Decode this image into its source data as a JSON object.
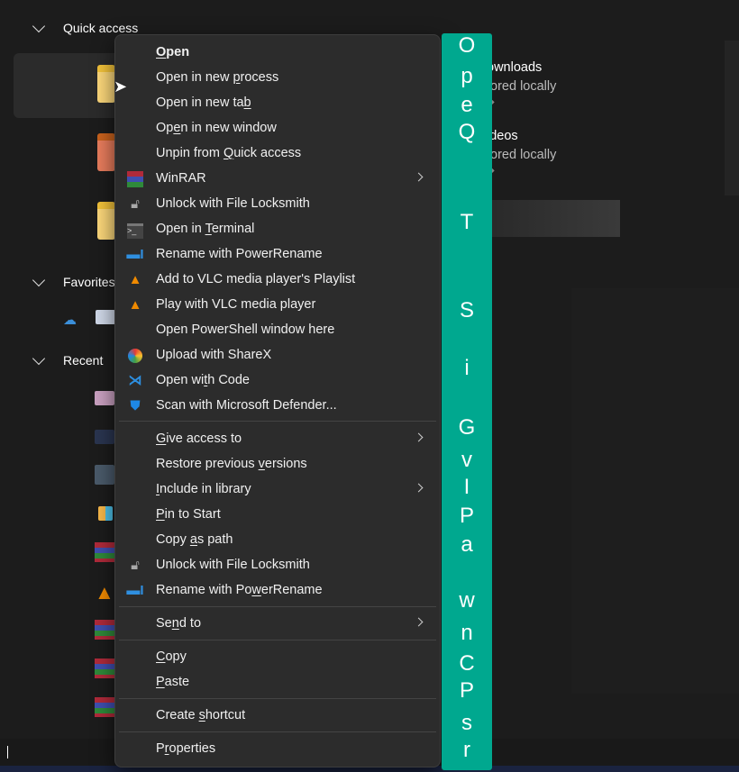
{
  "sidebar": {
    "quick_access": "Quick access",
    "favorites": "Favorites",
    "recent": "Recent"
  },
  "right_items": [
    {
      "name": "Downloads",
      "visible_name": "ownloads",
      "status": "Stored locally",
      "visible_status": "tored locally"
    },
    {
      "name": "Videos",
      "visible_name": "ideos",
      "status": "Stored locally",
      "visible_status": "tored locally"
    }
  ],
  "context_menu": {
    "groups": [
      [
        {
          "label": "Open",
          "key": 0,
          "bold": true
        },
        {
          "label": "Open in new process",
          "key": 12
        },
        {
          "label": "Open in new tab",
          "key": 14
        },
        {
          "label": "Open in new window",
          "key": 2
        },
        {
          "label": "Unpin from Quick access",
          "key": 11
        },
        {
          "label": "WinRAR",
          "icon": "winrar-icon",
          "submenu": true
        },
        {
          "label": "Unlock with File Locksmith",
          "icon": "lock-icon"
        },
        {
          "label": "Open in Terminal",
          "key": 8,
          "icon": "terminal-icon"
        },
        {
          "label": "Rename with PowerRename",
          "icon": "powerrename-icon"
        },
        {
          "label": "Add to VLC media player's Playlist",
          "icon": "vlc-icon"
        },
        {
          "label": "Play with VLC media player",
          "icon": "vlc-icon"
        },
        {
          "label": "Open PowerShell window here"
        },
        {
          "label": "Upload with ShareX",
          "icon": "sharex-icon"
        },
        {
          "label": "Open with Code",
          "key": 7,
          "icon": "vscode-icon"
        },
        {
          "label": "Scan with Microsoft Defender...",
          "icon": "defender-shield-icon"
        }
      ],
      [
        {
          "label": "Give access to",
          "key": 0,
          "submenu": true
        },
        {
          "label": "Restore previous versions",
          "key": 17
        },
        {
          "label": "Include in library",
          "key": 0,
          "submenu": true
        },
        {
          "label": "Pin to Start",
          "key": 0
        },
        {
          "label": "Copy as path",
          "key": 5
        },
        {
          "label": "Unlock with File Locksmith",
          "icon": "lock-icon"
        },
        {
          "label": "Rename with PowerRename",
          "key": 14,
          "icon": "powerrename-icon"
        }
      ],
      [
        {
          "label": "Send to",
          "key": 2,
          "submenu": true
        }
      ],
      [
        {
          "label": "Copy",
          "key": 0
        },
        {
          "label": "Paste",
          "key": 0
        }
      ],
      [
        {
          "label": "Create shortcut",
          "key": 7
        }
      ],
      [
        {
          "label": "Properties",
          "key": 1
        }
      ]
    ]
  },
  "accelerator_strip": {
    "letters": [
      "O",
      "p",
      "e",
      "Q",
      "T",
      "S",
      "i",
      "G",
      "v",
      "I",
      "P",
      "a",
      "w",
      "n",
      "C",
      "P",
      "s",
      "r"
    ],
    "color": "#00a88f"
  }
}
